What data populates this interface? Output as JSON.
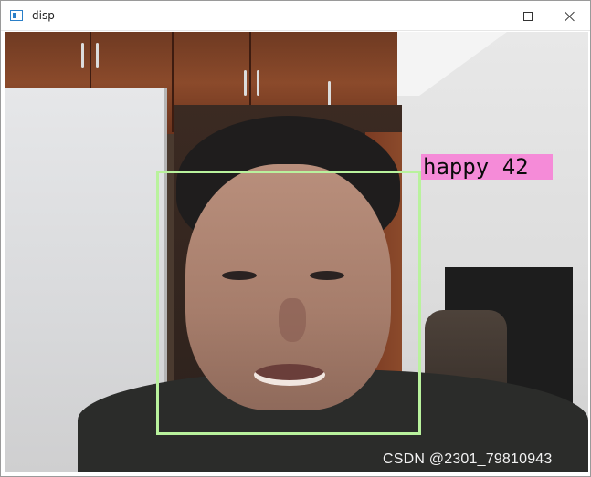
{
  "window": {
    "title": "disp",
    "icon": "window-app-icon",
    "controls": {
      "minimize_icon": "minimize-icon",
      "maximize_icon": "maximize-icon",
      "close_icon": "close-icon"
    }
  },
  "overlay": {
    "emotion_label": "happy 42",
    "box_color": "#b9f29d",
    "label_color": "#f58bd8"
  },
  "watermark": {
    "text": "CSDN @2301_79810943"
  }
}
